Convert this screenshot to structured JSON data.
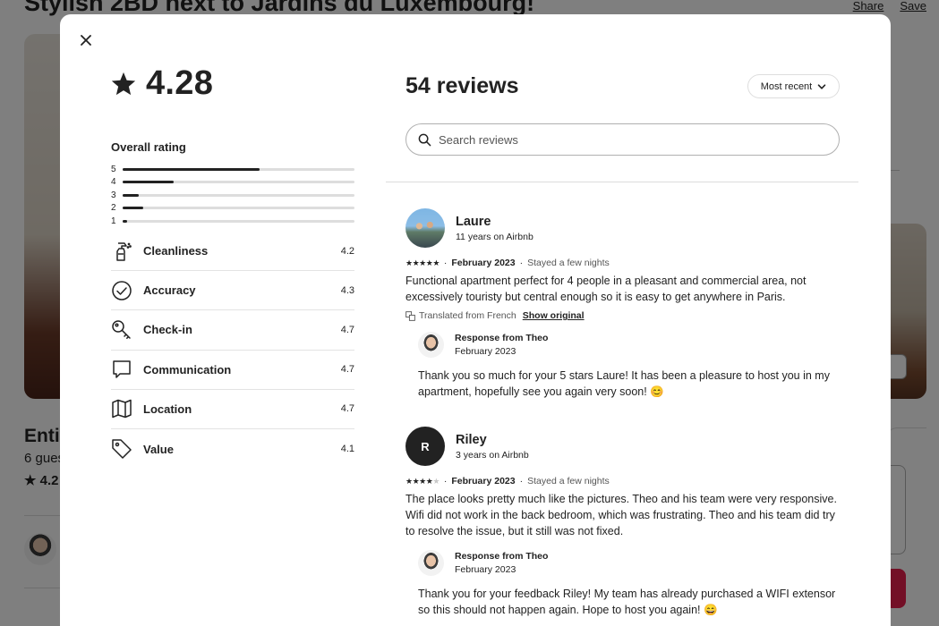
{
  "background": {
    "title": "Stylish 2BD next to Jardins du Luxembourg!",
    "share_label": "Share",
    "save_label": "Save",
    "listing_type": "Entir",
    "guests": "6 gues",
    "rating": "4.2"
  },
  "modal": {
    "overall_rating": "4.28",
    "overall_label": "Overall rating",
    "distribution": [
      {
        "stars": "5",
        "fraction": 0.59
      },
      {
        "stars": "4",
        "fraction": 0.22
      },
      {
        "stars": "3",
        "fraction": 0.07
      },
      {
        "stars": "2",
        "fraction": 0.09
      },
      {
        "stars": "1",
        "fraction": 0.02
      }
    ],
    "categories": [
      {
        "label": "Cleanliness",
        "value": "4.2",
        "icon": "spray-bottle-icon"
      },
      {
        "label": "Accuracy",
        "value": "4.3",
        "icon": "check-circle-icon"
      },
      {
        "label": "Check-in",
        "value": "4.7",
        "icon": "key-icon"
      },
      {
        "label": "Communication",
        "value": "4.7",
        "icon": "chat-bubble-icon"
      },
      {
        "label": "Location",
        "value": "4.7",
        "icon": "map-icon"
      },
      {
        "label": "Value",
        "value": "4.1",
        "icon": "tag-icon"
      }
    ],
    "reviews_count_title": "54 reviews",
    "sort_label": "Most recent",
    "search_placeholder": "Search reviews",
    "reviews": [
      {
        "name": "Laure",
        "tenure": "11 years on Airbnb",
        "rating": 5,
        "date": "February 2023",
        "stay": "Stayed a few nights",
        "text": "Functional apartment perfect for 4 people in a pleasant and commercial area, not excessively touristy but central enough so it is easy to get anywhere in Paris.",
        "translated": "Translated from French",
        "show_original": "Show original",
        "response": {
          "title": "Response from Theo",
          "date": "February 2023",
          "text": "Thank you so much for your 5 stars Laure! It has been a pleasure to host you in my apartment, hopefully see you again very soon! 😊"
        }
      },
      {
        "name": "Riley",
        "initial": "R",
        "tenure": "3 years on Airbnb",
        "rating": 4,
        "date": "February 2023",
        "stay": "Stayed a few nights",
        "text": "The place looks pretty much like the pictures. Theo and his team were very responsive. Wifi did not work in the back bedroom, which was frustrating. Theo and his team did try to resolve the issue, but it still was not fixed.",
        "response": {
          "title": "Response from Theo",
          "date": "February 2023",
          "text": "Thank you for your feedback Riley! My team has already purchased a WIFI extensor so this should not happen again. Hope to host you again! 😄"
        }
      }
    ]
  }
}
